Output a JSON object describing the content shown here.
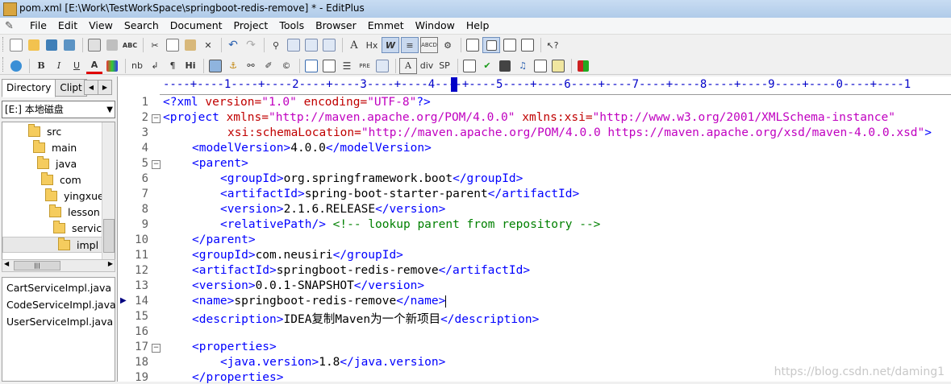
{
  "window": {
    "title": "pom.xml [E:\\Work\\TestWorkSpace\\springboot-redis-remove] * - EditPlus"
  },
  "menu": [
    "File",
    "Edit",
    "View",
    "Search",
    "Document",
    "Project",
    "Tools",
    "Browser",
    "Emmet",
    "Window",
    "Help"
  ],
  "toolbar2_labels": {
    "nb": "nb",
    "para": "¶",
    "hi": "Hi",
    "pre": "PRE",
    "hx": "Hx",
    "div": "div",
    "sp": "SP",
    "bold": "B",
    "italic": "I",
    "underline": "U",
    "color_a": "A"
  },
  "panel": {
    "tabs": [
      "Directory",
      "Clipt"
    ],
    "drive": "[E:] 本地磁盘",
    "tree": [
      "src",
      "main",
      "java",
      "com",
      "yingxue",
      "lesson",
      "service",
      "impl"
    ],
    "selected_folder": "impl",
    "files": [
      "CartServiceImpl.java",
      "CodeServiceImpl.java",
      "UserServiceImpl.java"
    ]
  },
  "ruler": "----+----1----+----2----+----3----+----4----+----5----+----6----+----7----+----8----+----9----+----0----+----1",
  "code": {
    "line_numbers": [
      "1",
      "2",
      "3",
      "4",
      "5",
      "6",
      "7",
      "8",
      "9",
      "10",
      "11",
      "12",
      "13",
      "14",
      "15",
      "16",
      "17",
      "18",
      "19"
    ],
    "l1": {
      "open": "<?xml ",
      "a1": "version=",
      "v1": "\"1.0\"",
      "a2": " encoding=",
      "v2": "\"UTF-8\"",
      "close": "?>"
    },
    "l2": {
      "tag": "<project ",
      "a1": "xmlns=",
      "v1": "\"http://maven.apache.org/POM/4.0.0\"",
      "a2": " xmlns:xsi=",
      "v2": "\"http://www.w3.org/2001/XMLSchema-instance\""
    },
    "l3": {
      "a1": "xsi:schemaLocation=",
      "v1": "\"http://maven.apache.org/POM/4.0.0 https://maven.apache.org/xsd/maven-4.0.0.xsd\"",
      "close": ">"
    },
    "l4": {
      "open": "<modelVersion>",
      "text": "4.0.0",
      "close": "</modelVersion>"
    },
    "l5": {
      "open": "<parent>"
    },
    "l6": {
      "open": "<groupId>",
      "text": "org.springframework.boot",
      "close": "</groupId>"
    },
    "l7": {
      "open": "<artifactId>",
      "text": "spring-boot-starter-parent",
      "close": "</artifactId>"
    },
    "l8": {
      "open": "<version>",
      "text": "2.1.6.RELEASE",
      "close": "</version>"
    },
    "l9": {
      "open": "<relativePath/>",
      "comment": " <!-- lookup parent from repository -->"
    },
    "l10": {
      "close": "</parent>"
    },
    "l11": {
      "open": "<groupId>",
      "text": "com.neusiri",
      "close": "</groupId>"
    },
    "l12": {
      "open": "<artifactId>",
      "text": "springboot-redis-remove",
      "close": "</artifactId>"
    },
    "l13": {
      "open": "<version>",
      "text": "0.0.1-SNAPSHOT",
      "close": "</version>"
    },
    "l14": {
      "open": "<name>",
      "text": "springboot-redis-remove",
      "close": "</name>"
    },
    "l15": {
      "open": "<description>",
      "text": "IDEA复制Maven为一个新项目",
      "close": "</description>"
    },
    "l17": {
      "open": "<properties>"
    },
    "l18": {
      "open": "<java.version>",
      "text": "1.8",
      "close": "</java.version>"
    },
    "l19": {
      "close": "</properties>"
    }
  },
  "watermark": "https://blog.csdn.net/daming1",
  "colors": {
    "tag": "#0000ff",
    "attr": "#c00000",
    "value": "#c000c0",
    "comment": "#008000",
    "ruler": "#0000c8"
  }
}
